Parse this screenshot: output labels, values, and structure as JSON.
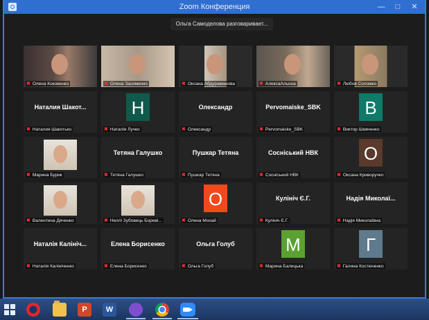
{
  "window": {
    "title": "Zoom Конференция"
  },
  "speaking_banner": "Ольга Самоделова разговаривает...",
  "participants": [
    {
      "label": "Олена Коковенко",
      "type": "video"
    },
    {
      "label": "Олена Засименко",
      "type": "video"
    },
    {
      "label": "Оксана Абдураманова",
      "type": "video"
    },
    {
      "label": "АлексаАльона",
      "type": "video"
    },
    {
      "label": "Любов Соломко",
      "type": "video"
    },
    {
      "label": "Наталия Шакотько",
      "type": "name",
      "display": "Наталия  Шакот..."
    },
    {
      "label": "Наталія Лучко",
      "type": "avatar",
      "letter": "Н",
      "color": "#0f5a4a"
    },
    {
      "label": "Олександр",
      "type": "name",
      "display": "Олександр"
    },
    {
      "label": "Pervomaiske_SBK",
      "type": "name",
      "display": "Pervomaiske_SBK"
    },
    {
      "label": "Виктор Шевченко",
      "type": "avatar",
      "letter": "В",
      "color": "#0f7a6a"
    },
    {
      "label": "Марина Бурик",
      "type": "photo"
    },
    {
      "label": "Тетяна Галушко",
      "type": "name",
      "display": "Тетяна Галушко"
    },
    {
      "label": "Пушкар Тетяна",
      "type": "name",
      "display": "Пушкар Тетяна"
    },
    {
      "label": "Сосніський НВК",
      "type": "name",
      "display": "Сосніський НВК"
    },
    {
      "label": "Оксана Криворучко",
      "type": "avatar",
      "letter": "О",
      "color": "#5a3a2c"
    },
    {
      "label": "Валентина Дяченко",
      "type": "photo"
    },
    {
      "label": "Неллі Зубовець Бореві...",
      "type": "photo"
    },
    {
      "label": "Олена Мохай",
      "type": "avatar",
      "letter": "О",
      "color": "#f04a1a"
    },
    {
      "label": "Кулініч Є.Г.",
      "type": "name",
      "display": "Кулініч Є.Г."
    },
    {
      "label": "Надія Миколаївна",
      "type": "name",
      "display": "Надія  Миколаї..."
    },
    {
      "label": "Наталія Калініченко",
      "type": "name",
      "display": "Наталія Калініч..."
    },
    {
      "label": "Елена Борисенко",
      "type": "name",
      "display": "Елена Борисенко"
    },
    {
      "label": "Ольга Голуб",
      "type": "name",
      "display": "Ольга Голуб"
    },
    {
      "label": "Марина Балицька",
      "type": "avatar",
      "letter": "М",
      "color": "#5aa032"
    },
    {
      "label": "Галина Костюченко",
      "type": "avatar",
      "letter": "Г",
      "color": "#5f7a8c"
    }
  ],
  "taskbar": {
    "items": [
      "start",
      "opera",
      "file-explorer",
      "powerpoint",
      "word",
      "viber",
      "chrome",
      "zoom"
    ],
    "ppt_glyph": "P",
    "word_glyph": "W"
  }
}
